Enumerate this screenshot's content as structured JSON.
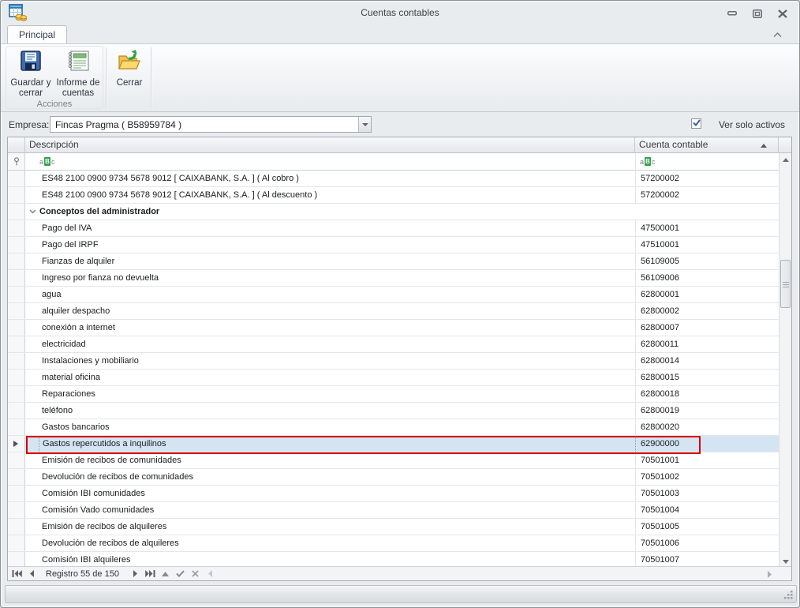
{
  "window": {
    "title": "Cuentas contables"
  },
  "ribbon": {
    "tab": "Principal",
    "buttons": [
      {
        "label": "Guardar y cerrar"
      },
      {
        "label": "Informe de cuentas"
      },
      {
        "label": "Cerrar"
      }
    ],
    "group_label": "Acciones"
  },
  "filters": {
    "empresa_label": "Empresa:",
    "empresa_value": "Fincas Pragma ( B58959784 )",
    "checkbox_label": "Ver solo activos",
    "checkbox_checked": true
  },
  "grid": {
    "columns": [
      {
        "label": "Descripción"
      },
      {
        "label": "Cuenta contable",
        "sorted": "asc"
      }
    ],
    "abc": [
      "a",
      "B",
      "c"
    ],
    "selection_color": "#d5e4f3",
    "highlight_color": "#d40000",
    "rows": [
      {
        "desc": "ES48 2100 0900 9734 5678 9012 [ CAIXABANK, S.A. ] ( Al cobro )",
        "cuenta": "57200002"
      },
      {
        "desc": "ES48 2100 0900 9734 5678 9012 [ CAIXABANK, S.A. ] ( Al descuento )",
        "cuenta": "57200002"
      },
      {
        "desc": "Conceptos del administrador",
        "cuenta": "",
        "group": true
      },
      {
        "desc": "Pago del IVA",
        "cuenta": "47500001"
      },
      {
        "desc": "Pago del IRPF",
        "cuenta": "47510001"
      },
      {
        "desc": "Fianzas de alquiler",
        "cuenta": "56109005"
      },
      {
        "desc": "Ingreso por fianza no devuelta",
        "cuenta": "56109006"
      },
      {
        "desc": "agua",
        "cuenta": "62800001"
      },
      {
        "desc": "alquiler despacho",
        "cuenta": "62800002"
      },
      {
        "desc": "conexión a internet",
        "cuenta": "62800007"
      },
      {
        "desc": "electricidad",
        "cuenta": "62800011"
      },
      {
        "desc": "Instalaciones y mobiliario",
        "cuenta": "62800014"
      },
      {
        "desc": "material oficina",
        "cuenta": "62800015"
      },
      {
        "desc": "Reparaciones",
        "cuenta": "62800018"
      },
      {
        "desc": "teléfono",
        "cuenta": "62800019"
      },
      {
        "desc": "Gastos bancarios",
        "cuenta": "62800020"
      },
      {
        "desc": "Gastos repercutidos a inquilinos",
        "cuenta": "62900000",
        "selected": true
      },
      {
        "desc": "Emisión de recibos de comunidades",
        "cuenta": "70501001"
      },
      {
        "desc": "Devolución de recibos de comunidades",
        "cuenta": "70501002"
      },
      {
        "desc": "Comisión IBI comunidades",
        "cuenta": "70501003"
      },
      {
        "desc": "Comisión Vado comunidades",
        "cuenta": "70501004"
      },
      {
        "desc": "Emisión de recibos de alquileres",
        "cuenta": "70501005"
      },
      {
        "desc": "Devolución de recibos de alquileres",
        "cuenta": "70501006"
      },
      {
        "desc": "Comisión IBI alquileres",
        "cuenta": "70501007"
      }
    ]
  },
  "navigator": {
    "record_label": "Registro 55 de 150"
  }
}
